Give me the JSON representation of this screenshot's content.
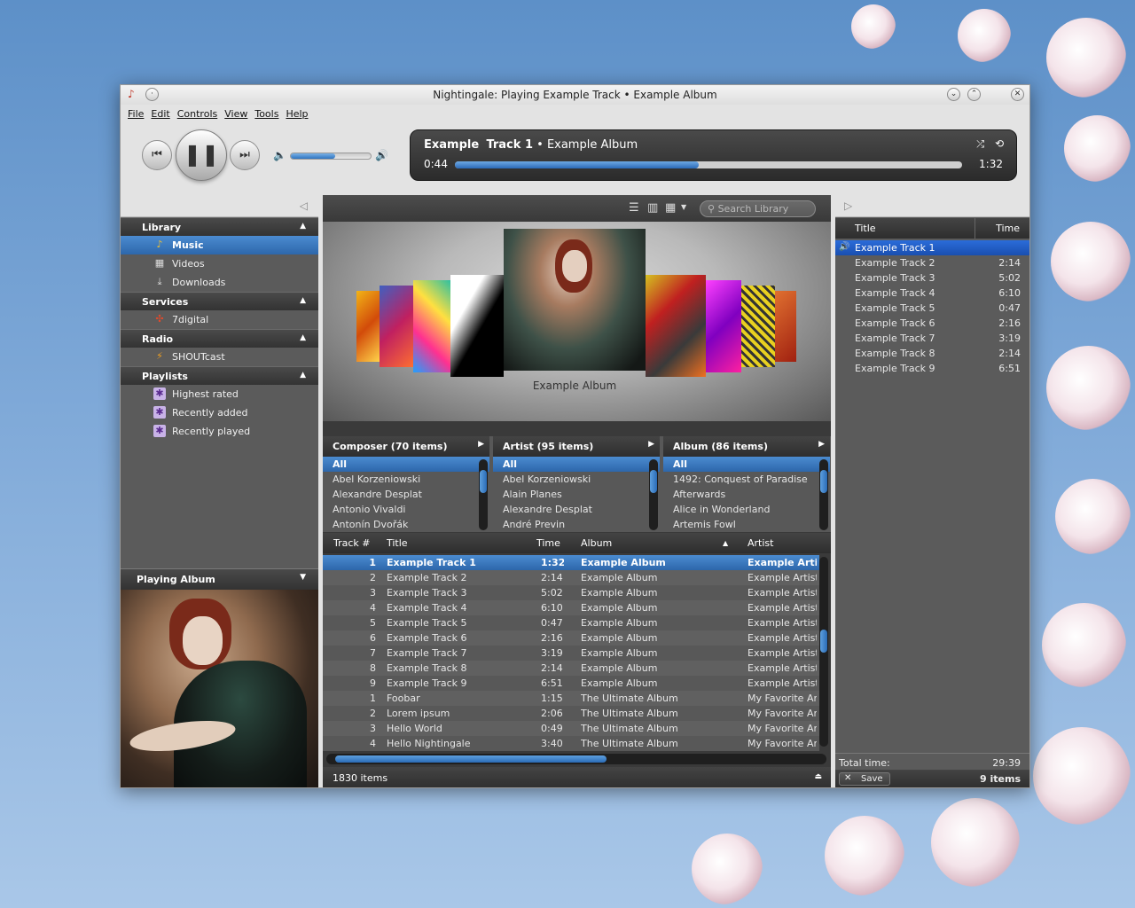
{
  "window": {
    "title": "Nightingale: Playing Example Track • Example Album"
  },
  "menu": [
    "File",
    "Edit",
    "Controls",
    "View",
    "Tools",
    "Help"
  ],
  "transport": {
    "prev": "prev-icon",
    "play_pause": "pause-icon",
    "next": "next-icon",
    "volume_level": 0.55
  },
  "now_playing": {
    "artist": "Example",
    "track": "Track 1",
    "separator": "•",
    "album": "Example Album",
    "elapsed": "0:44",
    "duration": "1:32",
    "progress": 0.48
  },
  "sidebar": {
    "sections": [
      {
        "title": "Library",
        "items": [
          {
            "label": "Music",
            "icon": "music-note-icon",
            "selected": true
          },
          {
            "label": "Videos",
            "icon": "film-icon"
          },
          {
            "label": "Downloads",
            "icon": "download-icon"
          }
        ]
      },
      {
        "title": "Services",
        "items": [
          {
            "label": "7digital",
            "icon": "7digital-icon"
          }
        ]
      },
      {
        "title": "Radio",
        "items": [
          {
            "label": "SHOUTcast",
            "icon": "shoutcast-icon"
          }
        ]
      },
      {
        "title": "Playlists",
        "items": [
          {
            "label": "Highest rated",
            "icon": "smart-playlist-icon"
          },
          {
            "label": "Recently added",
            "icon": "smart-playlist-icon"
          },
          {
            "label": "Recently played",
            "icon": "smart-playlist-icon"
          }
        ]
      }
    ],
    "playing_album_label": "Playing Album"
  },
  "library": {
    "search_placeholder": "Search Library",
    "coverflow_caption": "Example Album",
    "filters": [
      {
        "header": "Composer (70 items)",
        "rows": [
          "All",
          "Abel Korzeniowski",
          "Alexandre Desplat",
          "Antonio Vivaldi",
          "Antonín Dvořák"
        ]
      },
      {
        "header": "Artist (95 items)",
        "rows": [
          "All",
          "Abel Korzeniowski",
          "Alain Planes",
          "Alexandre Desplat",
          "André Previn"
        ]
      },
      {
        "header": "Album (86 items)",
        "rows": [
          "All",
          "1492: Conquest of Paradise",
          "Afterwards",
          "Alice in Wonderland",
          "Artemis Fowl"
        ]
      }
    ],
    "columns": {
      "track": "Track #",
      "title": "Title",
      "time": "Time",
      "album": "Album",
      "artist": "Artist"
    },
    "tracks": [
      {
        "n": "1",
        "title": "Example Track 1",
        "time": "1:32",
        "album": "Example Album",
        "artist": "Example Artist"
      },
      {
        "n": "2",
        "title": "Example Track 2",
        "time": "2:14",
        "album": "Example Album",
        "artist": "Example Artist"
      },
      {
        "n": "3",
        "title": "Example Track 3",
        "time": "5:02",
        "album": "Example Album",
        "artist": "Example Artist"
      },
      {
        "n": "4",
        "title": "Example Track 4",
        "time": "6:10",
        "album": "Example Album",
        "artist": "Example Artist"
      },
      {
        "n": "5",
        "title": "Example Track 5",
        "time": "0:47",
        "album": "Example Album",
        "artist": "Example Artist"
      },
      {
        "n": "6",
        "title": "Example Track 6",
        "time": "2:16",
        "album": "Example Album",
        "artist": "Example Artist"
      },
      {
        "n": "7",
        "title": "Example Track 7",
        "time": "3:19",
        "album": "Example Album",
        "artist": "Example Artist"
      },
      {
        "n": "8",
        "title": "Example Track 8",
        "time": "2:14",
        "album": "Example Album",
        "artist": "Example Artist"
      },
      {
        "n": "9",
        "title": "Example Track 9",
        "time": "6:51",
        "album": "Example Album",
        "artist": "Example Artist"
      },
      {
        "n": "1",
        "title": "Foobar",
        "time": "1:15",
        "album": "The Ultimate Album",
        "artist": "My Favorite Artist"
      },
      {
        "n": "2",
        "title": "Lorem ipsum",
        "time": "2:06",
        "album": "The Ultimate Album",
        "artist": "My Favorite Artist"
      },
      {
        "n": "3",
        "title": "Hello World",
        "time": "0:49",
        "album": "The Ultimate Album",
        "artist": "My Favorite Artist"
      },
      {
        "n": "4",
        "title": "Hello Nightingale",
        "time": "3:40",
        "album": "The Ultimate Album",
        "artist": "My Favorite Artist"
      }
    ],
    "status": "1830 items"
  },
  "playqueue": {
    "columns": {
      "title": "Title",
      "time": "Time"
    },
    "tracks": [
      {
        "title": "Example Track 1",
        "time": ""
      },
      {
        "title": "Example Track 2",
        "time": "2:14"
      },
      {
        "title": "Example Track 3",
        "time": "5:02"
      },
      {
        "title": "Example Track 4",
        "time": "6:10"
      },
      {
        "title": "Example Track 5",
        "time": "0:47"
      },
      {
        "title": "Example Track 6",
        "time": "2:16"
      },
      {
        "title": "Example Track 7",
        "time": "3:19"
      },
      {
        "title": "Example Track 8",
        "time": "2:14"
      },
      {
        "title": "Example Track 9",
        "time": "6:51"
      }
    ],
    "total_label": "Total time:",
    "total_time": "29:39",
    "save_label": "Save",
    "count": "9 items"
  },
  "colors": {
    "accent": "#2f74c0",
    "dark_panel": "#3a3a3a"
  }
}
